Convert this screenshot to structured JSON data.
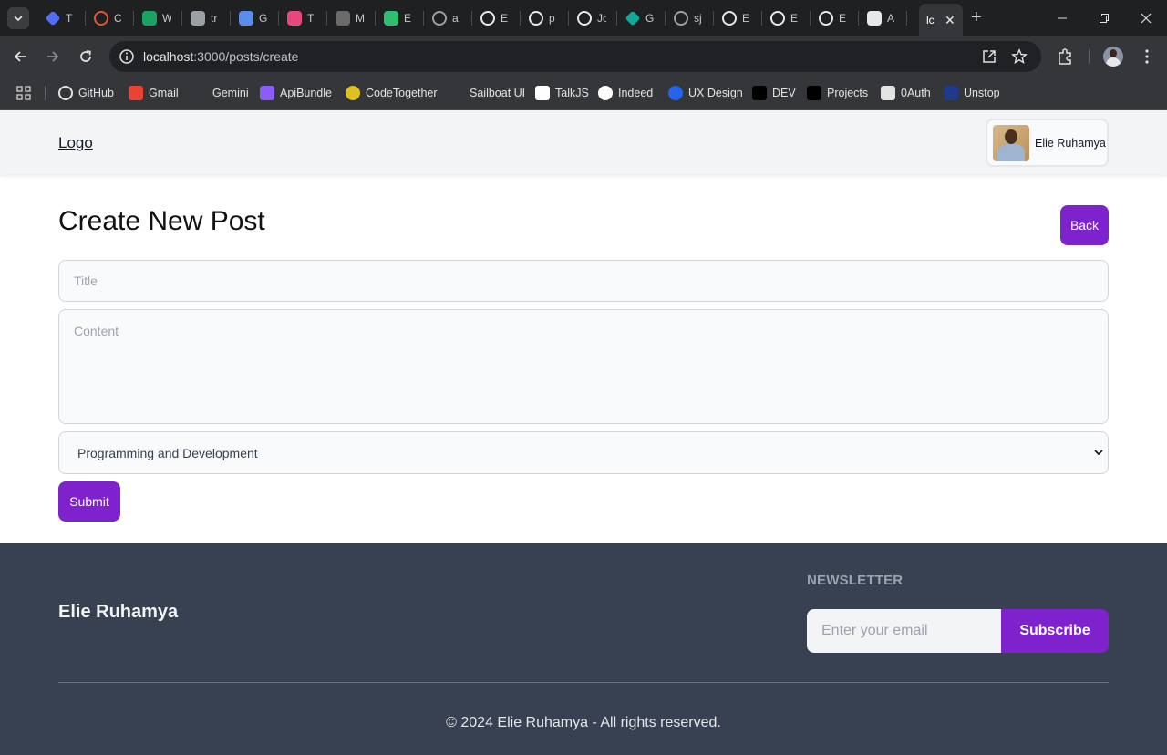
{
  "browser": {
    "tabs": [
      {
        "label": "T",
        "icon": "diamond-blue-icon",
        "color": "#4f6df5"
      },
      {
        "label": "C",
        "icon": "ring-icon",
        "color": "#e5533d"
      },
      {
        "label": "W",
        "icon": "w-logo-icon",
        "color": "#1aa260"
      },
      {
        "label": "tr",
        "icon": "translate-icon",
        "color": "#9aa0a6"
      },
      {
        "label": "G",
        "icon": "gemini-icon",
        "color": "#5b8def"
      },
      {
        "label": "T",
        "icon": "clickup-icon",
        "color": "#e8467c"
      },
      {
        "label": "M",
        "icon": "markdown-icon",
        "color": "#6b6b6b"
      },
      {
        "label": "E",
        "icon": "circle-green-icon",
        "color": "#2fbf71"
      },
      {
        "label": "a",
        "icon": "globe-icon",
        "color": "#9aa0a6"
      },
      {
        "label": "E",
        "icon": "github-icon",
        "color": "#e8e8e8"
      },
      {
        "label": "p",
        "icon": "github-icon",
        "color": "#e8e8e8"
      },
      {
        "label": "Jc",
        "icon": "github-icon",
        "color": "#e8e8e8"
      },
      {
        "label": "G",
        "icon": "diamond-teal-icon",
        "color": "#11a89a"
      },
      {
        "label": "sj",
        "icon": "globe-icon",
        "color": "#9aa0a6"
      },
      {
        "label": "E",
        "icon": "github-icon",
        "color": "#e8e8e8"
      },
      {
        "label": "E",
        "icon": "github-icon",
        "color": "#e8e8e8"
      },
      {
        "label": "E",
        "icon": "github-icon",
        "color": "#e8e8e8"
      },
      {
        "label": "A",
        "icon": "shield-icon",
        "color": "#e8e8e8"
      }
    ],
    "active_tab": {
      "label": "lc"
    },
    "url": {
      "host": "localhost",
      "path": ":3000/posts/create"
    },
    "bookmarks": [
      {
        "label": "GitHub",
        "icon": "github-icon"
      },
      {
        "label": "Gmail",
        "icon": "gmail-icon"
      },
      {
        "label": "Gemini",
        "icon": "gemini-icon"
      },
      {
        "label": "ApiBundle",
        "icon": "apibundle-icon"
      },
      {
        "label": "CodeTogether",
        "icon": "codetogether-icon"
      },
      {
        "label": "Sailboat UI",
        "icon": "sailboat-icon"
      },
      {
        "label": "TalkJS",
        "icon": "talkjs-icon"
      },
      {
        "label": "Indeed",
        "icon": "indeed-icon"
      },
      {
        "label": "UX Design",
        "icon": "uxdesign-icon"
      },
      {
        "label": "DEV",
        "icon": "dev-icon"
      },
      {
        "label": "Projects",
        "icon": "dev-icon"
      },
      {
        "label": "0Auth",
        "icon": "auth0-icon"
      },
      {
        "label": "Unstop",
        "icon": "unstop-icon"
      }
    ]
  },
  "header": {
    "logo": "Logo",
    "user_name": "Elie Ruhamya"
  },
  "form": {
    "heading": "Create New Post",
    "back_label": "Back",
    "title_placeholder": "Title",
    "content_placeholder": "Content",
    "category_selected": "Programming and Development",
    "submit_label": "Submit"
  },
  "footer": {
    "brand": "Elie Ruhamya",
    "newsletter_heading": "NEWSLETTER",
    "email_placeholder": "Enter your email",
    "subscribe_label": "Subscribe",
    "copyright": "© 2024 Elie Ruhamya - All rights reserved."
  },
  "colors": {
    "accent": "#7e22ce",
    "footer_bg": "#374151",
    "header_bg": "#f3f4f6"
  }
}
